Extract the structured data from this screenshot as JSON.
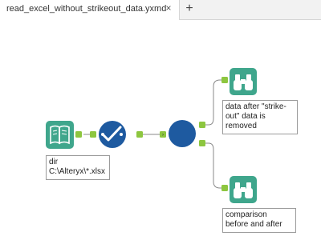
{
  "tab": {
    "title": "read_excel_without_strikeout_data.yxmd",
    "close_glyph": "×",
    "add_glyph": "+"
  },
  "tools": {
    "input": {
      "icon": "input-book-icon",
      "color": "#3fa68c"
    },
    "formula": {
      "icon": "checkmark-circle-icon",
      "color": "#1e5aa0"
    },
    "filter": {
      "icon": "circle-tool-icon",
      "color": "#1e5aa0"
    },
    "browse_top": {
      "icon": "binoculars-icon",
      "color": "#3fa68c"
    },
    "browse_bottom": {
      "icon": "binoculars-icon",
      "color": "#3fa68c"
    },
    "connector_color": "#8dc63f"
  },
  "annotations": {
    "input": {
      "line1": "dir",
      "line2": "C:\\Alteryx\\*.xlsx"
    },
    "browse_top": {
      "line1": "data after \"strike-",
      "line2": "out\" data is",
      "line3": "removed"
    },
    "browse_bottom": {
      "line1": "comparison",
      "line2": "before and after"
    }
  }
}
